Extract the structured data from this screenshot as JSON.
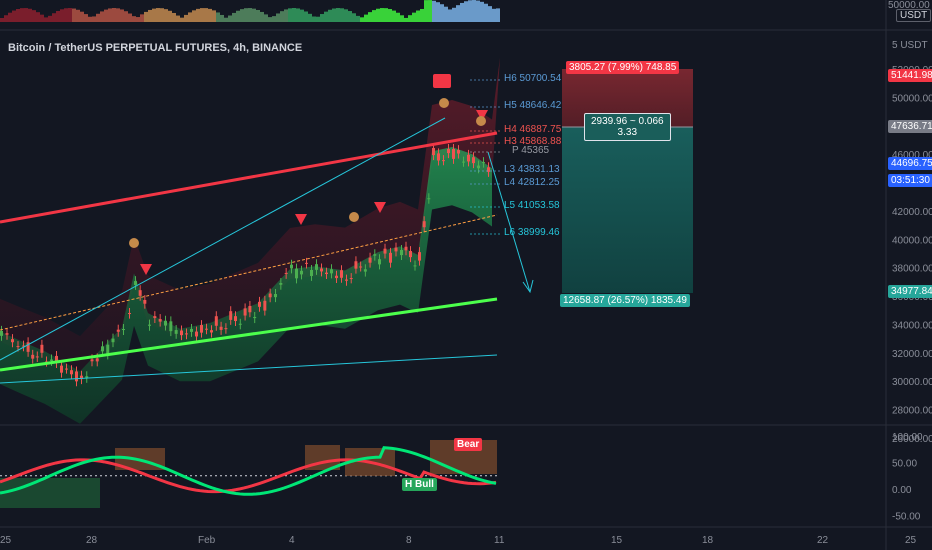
{
  "chart_title": "Bitcoin / TetherUS PERPETUAL FUTURES, 4h, BINANCE",
  "volume_axis": {
    "top_label": "50000.00",
    "unit": "USDT"
  },
  "price_axis": {
    "unit_label": "5 USDT",
    "ticks": [
      "52000.00",
      "50000.00",
      "48000.00",
      "46000.00",
      "44000.00",
      "42000.00",
      "40000.00",
      "38000.00",
      "36000.00",
      "34000.00",
      "32000.00",
      "30000.00",
      "28000.00",
      "26000.00"
    ],
    "badges": [
      {
        "text": "51441.98",
        "color": "#f23645"
      },
      {
        "text": "47636.71",
        "color": "#787b86"
      },
      {
        "text": "44696.75",
        "color": "#2962ff"
      },
      {
        "text": "03:51:30",
        "color": "#2962ff"
      },
      {
        "text": "34977.84",
        "color": "#26a69a"
      }
    ]
  },
  "osc_axis": {
    "ticks": [
      "100.00",
      "50.00",
      "0.00",
      "-50.00"
    ]
  },
  "time_axis": {
    "ticks": [
      "25",
      "28",
      "Feb",
      "4",
      "8",
      "11",
      "15",
      "18",
      "22",
      "25"
    ]
  },
  "pivot_levels": [
    {
      "label": "H6 50700.54",
      "color": "#5b9bd5"
    },
    {
      "label": "H5 48646.42",
      "color": "#5b9bd5"
    },
    {
      "label": "H4 46887.75",
      "color": "#ef5350"
    },
    {
      "label": "H3 45868.88",
      "color": "#ef5350"
    },
    {
      "label": "P 45365",
      "color": "#9598a1"
    },
    {
      "label": "L3 43831.13",
      "color": "#5b9bd5"
    },
    {
      "label": "L4 42812.25",
      "color": "#5b9bd5"
    },
    {
      "label": "L5 41053.58",
      "color": "#26c6da"
    },
    {
      "label": "L6 38999.46",
      "color": "#26c6da"
    }
  ],
  "position_tool": {
    "target_label": "3805.27 (7.99%) 748.85",
    "risk_reward_line1": "2939.96 ~ 0.066",
    "risk_reward_line2": "3.33",
    "stop_label": "12658.87 (26.57%) 1835.49"
  },
  "oscillator_labels": {
    "bull": "H Bull",
    "bear": "Bear"
  },
  "colors": {
    "background": "#131722",
    "bull": "#26a69a",
    "bear": "#ef5350",
    "accent": "#2962ff"
  },
  "chart_data": {
    "type": "candlestick",
    "title": "Bitcoin / TetherUS PERPETUAL FUTURES, 4h, BINANCE",
    "ylim": [
      25000,
      53500
    ],
    "x_ticks": [
      "25",
      "28",
      "Feb",
      "4",
      "8",
      "11",
      "15",
      "18",
      "22",
      "25"
    ],
    "close_path": [
      {
        "x": "25",
        "y": 33200
      },
      {
        "x": "26",
        "y": 32500
      },
      {
        "x": "27",
        "y": 31800
      },
      {
        "x": "28",
        "y": 30400
      },
      {
        "x": "29",
        "y": 33500
      },
      {
        "x": "29",
        "y": 37300
      },
      {
        "x": "30",
        "y": 34500
      },
      {
        "x": "31",
        "y": 33400
      },
      {
        "x": "Feb",
        "y": 33800
      },
      {
        "x": "2",
        "y": 35200
      },
      {
        "x": "3",
        "y": 37600
      },
      {
        "x": "4",
        "y": 37800
      },
      {
        "x": "5",
        "y": 37500
      },
      {
        "x": "6",
        "y": 38800
      },
      {
        "x": "7",
        "y": 39200
      },
      {
        "x": "8",
        "y": 38600
      },
      {
        "x": "8",
        "y": 45900
      },
      {
        "x": "9",
        "y": 46200
      },
      {
        "x": "10",
        "y": 45700
      },
      {
        "x": "11",
        "y": 44700
      }
    ],
    "trend_lines": [
      {
        "name": "red resistance",
        "color": "#f23645"
      },
      {
        "name": "green support",
        "color": "#4cff4c"
      },
      {
        "name": "cyan channel",
        "color": "#26c6da"
      }
    ]
  }
}
